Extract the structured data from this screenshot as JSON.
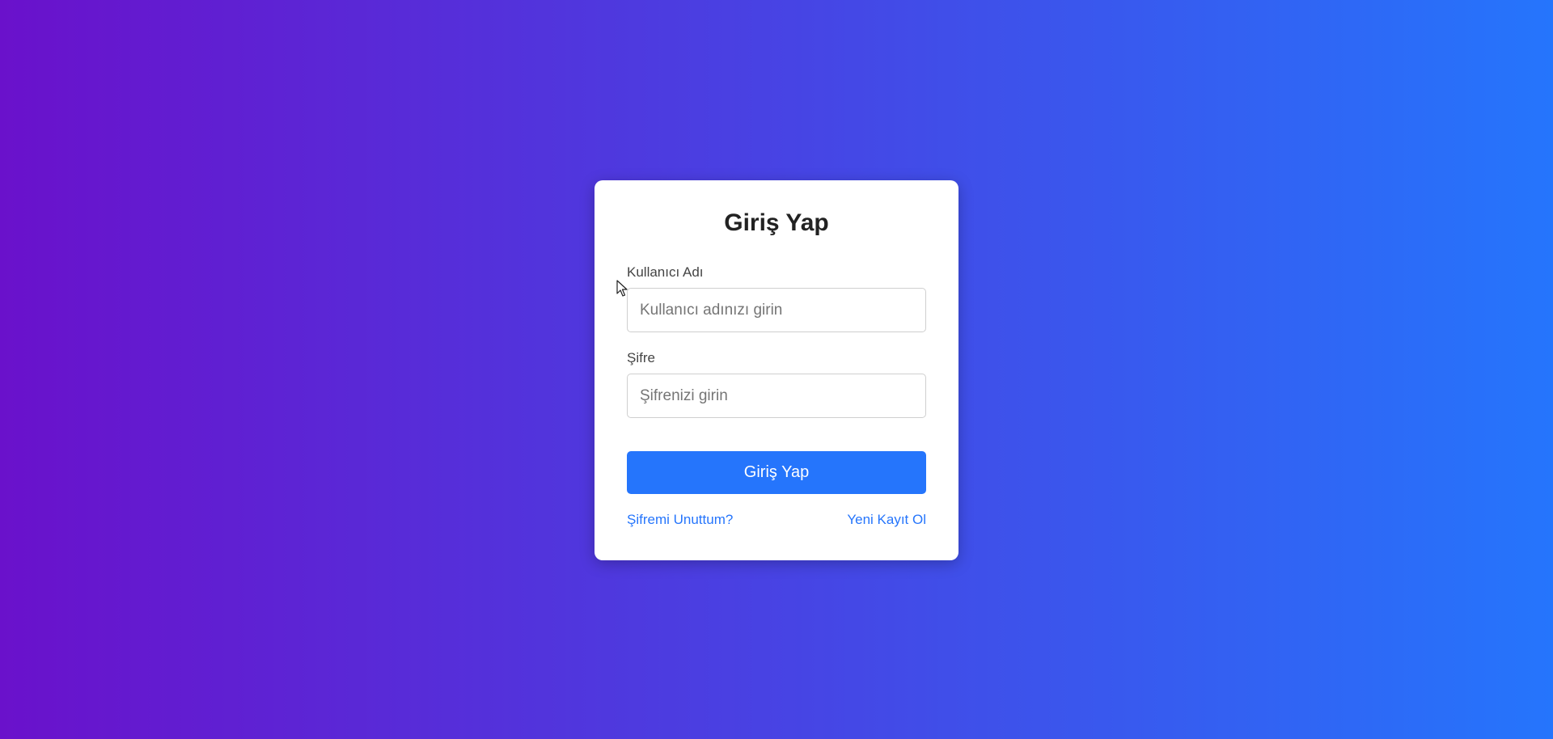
{
  "login": {
    "title": "Giriş Yap",
    "username": {
      "label": "Kullanıcı Adı",
      "placeholder": "Kullanıcı adınızı girin",
      "value": ""
    },
    "password": {
      "label": "Şifre",
      "placeholder": "Şifrenizi girin",
      "value": ""
    },
    "submit_label": "Giriş Yap",
    "forgot_link": "Şifremi Unuttum?",
    "register_link": "Yeni Kayıt Ol"
  },
  "colors": {
    "gradient_start": "#6a11cb",
    "gradient_end": "#2575fc",
    "accent": "#2575fc",
    "card_background": "#ffffff"
  },
  "icons": {
    "cursor": "mouse-pointer-icon"
  }
}
